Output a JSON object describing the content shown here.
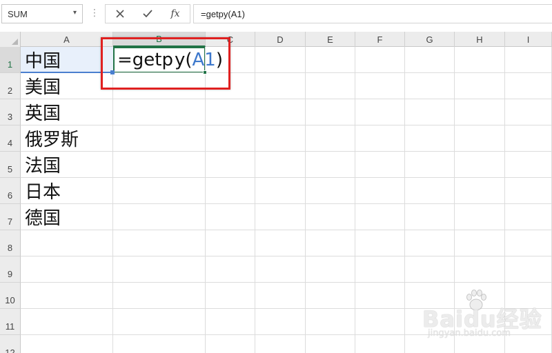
{
  "formula_bar": {
    "name_box": "SUM",
    "name_box_arrow": "▾",
    "separator": "⋮",
    "cancel_icon": "x-icon",
    "enter_icon": "check-icon",
    "fx_label": "fx",
    "formula": "=getpy(A1)"
  },
  "columns": [
    "A",
    "B",
    "C",
    "D",
    "E",
    "F",
    "G",
    "H",
    "I"
  ],
  "rows": [
    "1",
    "2",
    "3",
    "4",
    "5",
    "6",
    "7",
    "8",
    "9",
    "10",
    "11",
    "12"
  ],
  "cells": {
    "A": [
      "中国",
      "美国",
      "英国",
      "俄罗斯",
      "法国",
      "日本",
      "德国"
    ],
    "B1": {
      "prefix": "=getp",
      "after_caret": "y(",
      "ref": "A1",
      "suffix": ")"
    }
  },
  "active_cell": "B1",
  "colors": {
    "excel_green": "#217346",
    "reference_blue": "#3d78cc",
    "highlight_red": "#e02020"
  },
  "watermark": {
    "brand": "Baidu经验",
    "url": "jingyan.baidu.com"
  }
}
